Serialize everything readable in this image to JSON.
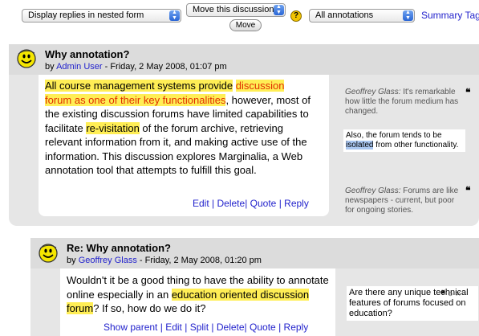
{
  "toolbar": {
    "display_mode": "Display replies in nested form",
    "move_select": "Move this discussion to ...",
    "move_button": "Move",
    "help": "?",
    "annotations_select": "All annotations",
    "summary_link": "Summary",
    "tags_link": "Tags"
  },
  "posts": [
    {
      "title": "Why annotation?",
      "by_prefix": "by",
      "author": "Admin User",
      "date": "- Friday, 2 May 2008, 01:07 pm",
      "text": {
        "a_hl": "All course management systems provide",
        "b_sp": " ",
        "c_hlred": "discussion forum as one of their key functionalities",
        "d": ", however, most of the existing discussion forums have limited capabilities to facilitate",
        "e_sp": " ",
        "f_hl": "re-visitation",
        "g": " of the forum archive, retrieving relevant information from it, and making active use of the information. This discussion explores Marginalia, a Web annotation tool that attempts to fulfill this goal."
      },
      "commands": [
        "Edit",
        "Delete",
        "Quote",
        "Reply"
      ],
      "notes": [
        {
          "author": "Geoffrey Glass:",
          "text": " It's remarkable how little the forum medium has changed."
        },
        {
          "pre": "Also, the forum tends to be ",
          "hl": "isolated",
          "post": " from other functionality."
        },
        {
          "author": "Geoffrey Glass:",
          "text": " Forums are like newspapers - current, but poor for ongoing stories."
        }
      ]
    },
    {
      "title": "Re: Why annotation?",
      "by_prefix": "by",
      "author": "Geoffrey Glass",
      "date": "- Friday, 2 May 2008, 01:20 pm",
      "text": {
        "a": "Wouldn't it be a good thing to have the ability to annotate online especially in an",
        "b_sp": " ",
        "c_hl": "education oriented discussion forum",
        "d": "? If so, how do we do it?"
      },
      "commands": [
        "Show parent",
        "Edit",
        "Split",
        "Delete",
        "Quote",
        "Reply"
      ],
      "notes": [
        {
          "text": "Are there any unique technical features of forums focused on education?"
        }
      ]
    }
  ],
  "icons": {
    "quote": "❝",
    "circle": "○",
    "close": "×"
  }
}
